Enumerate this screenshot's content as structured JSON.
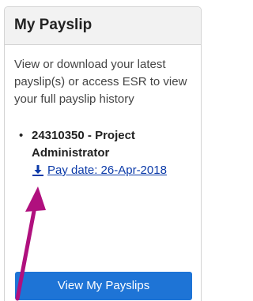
{
  "card": {
    "title": "My Payslip",
    "description": "View or download your latest payslip(s) or access ESR to view your full payslip history",
    "payslips": [
      {
        "bullet": "•",
        "name": "24310350 - Project Administrator",
        "link_label": "Pay date: 26-Apr-2018"
      }
    ],
    "button_label": "View My Payslips"
  },
  "icons": {
    "download": "download-icon",
    "arrow": "annotation-arrow"
  },
  "colors": {
    "header_bg": "#f2f2f2",
    "link": "#0b3aa8",
    "button": "#1e74d6",
    "arrow": "#b0107e"
  }
}
